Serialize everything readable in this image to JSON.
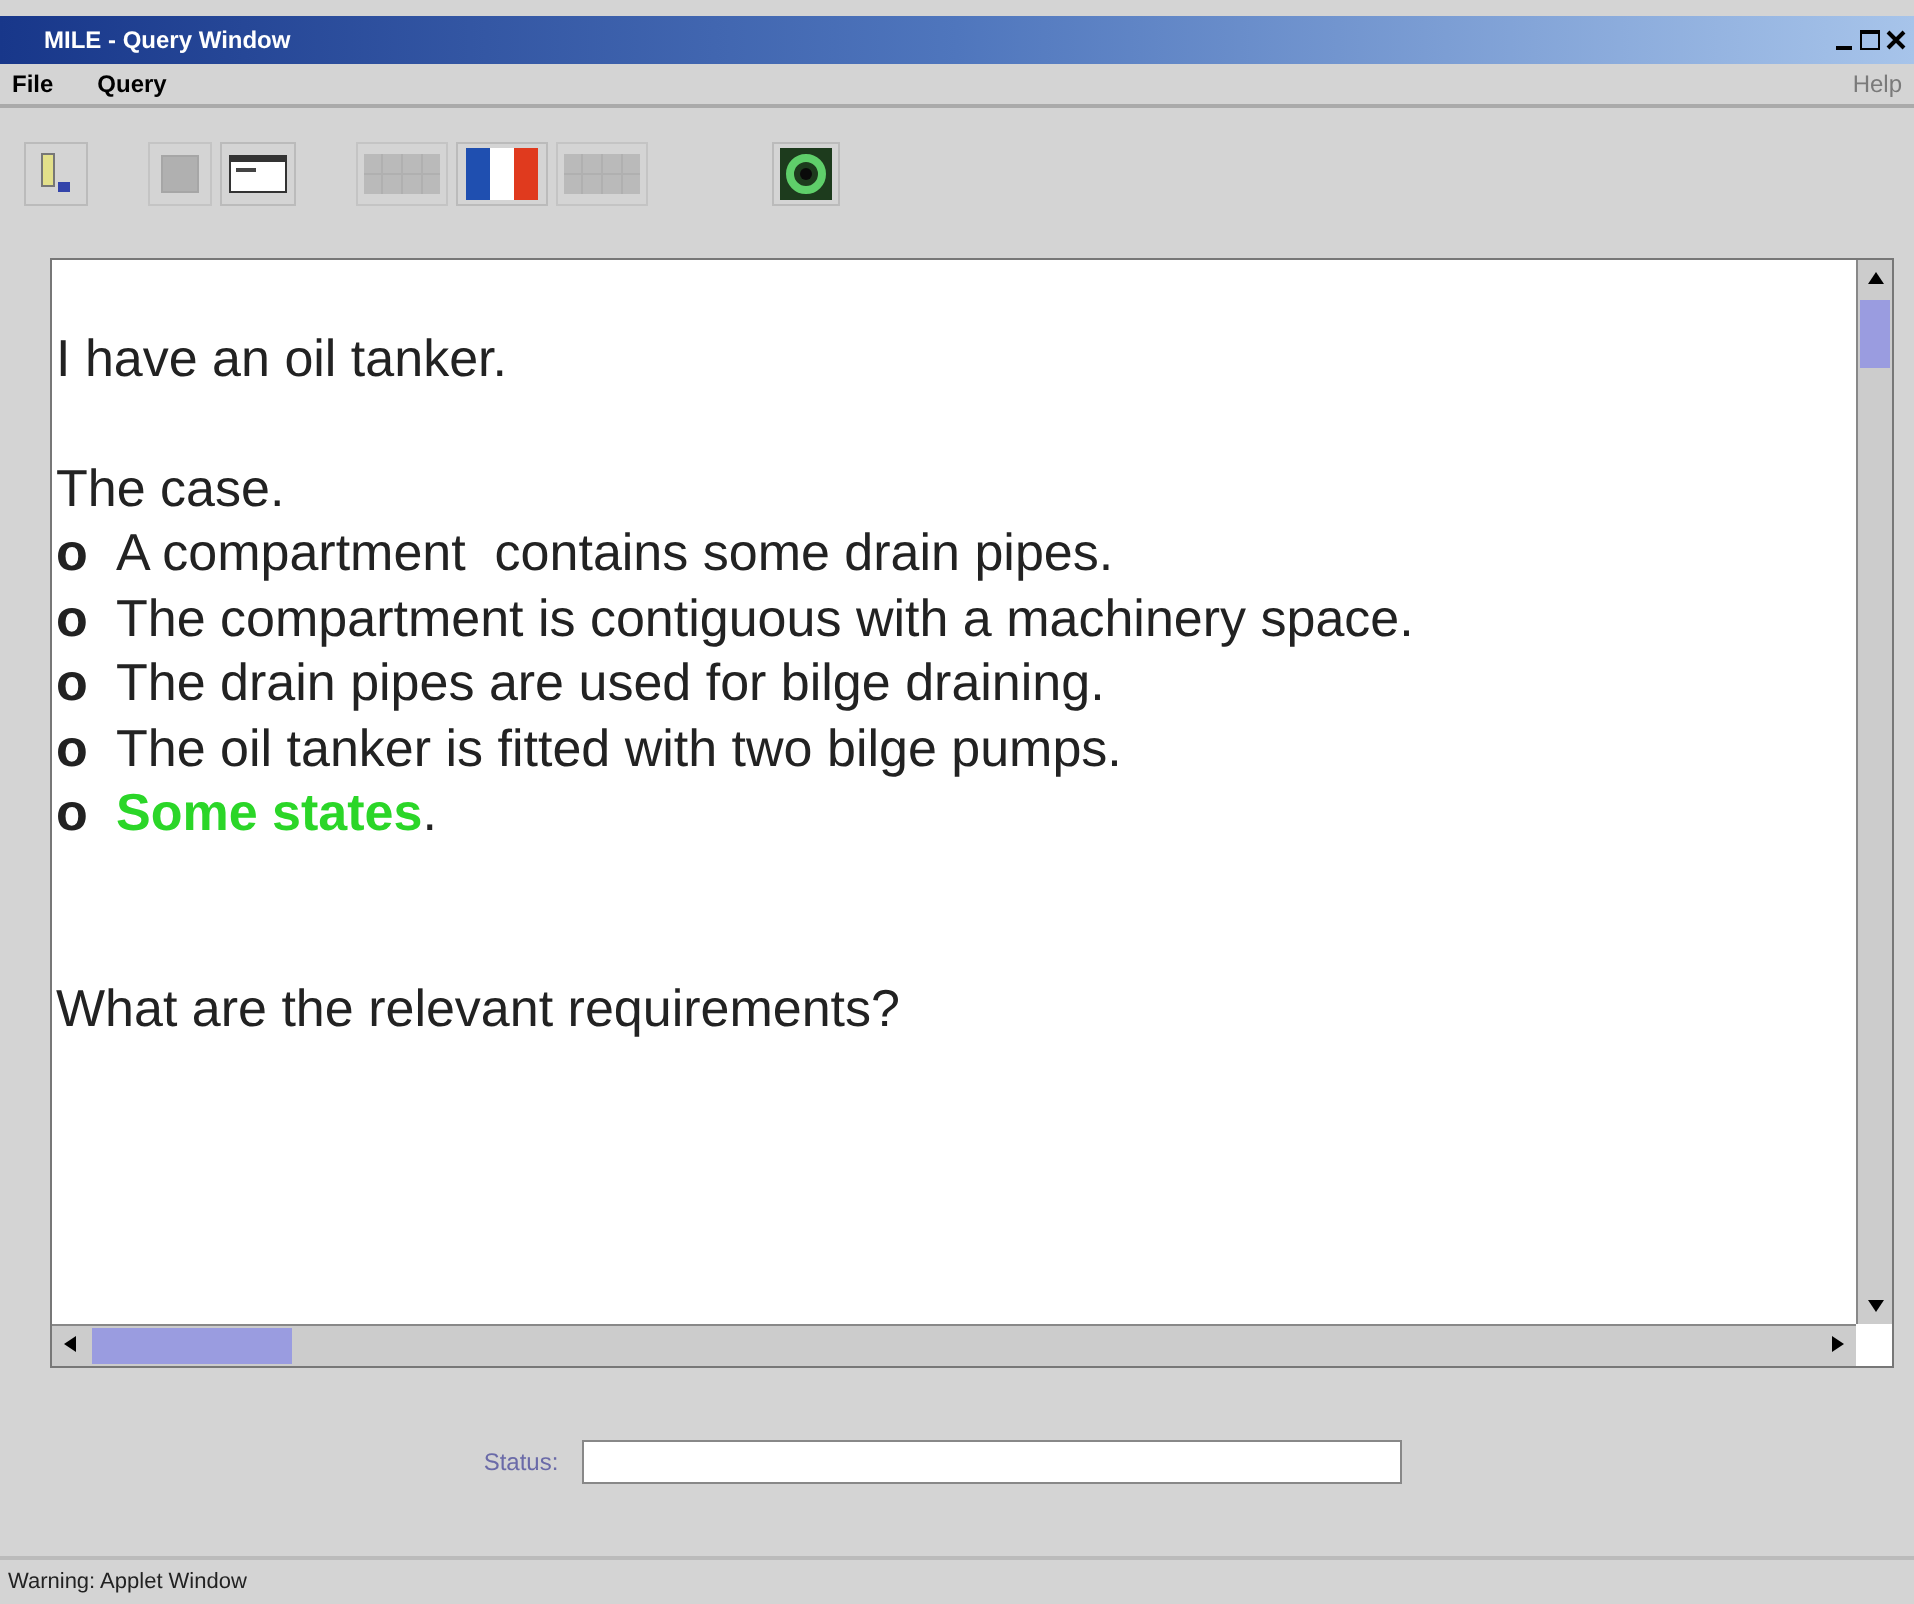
{
  "window": {
    "title": "MILE - Query Window"
  },
  "menu": [
    {
      "label": "File",
      "disabled": false
    },
    {
      "label": "Query",
      "disabled": false
    },
    {
      "label": "Help",
      "disabled": true
    }
  ],
  "toolbar": [
    {
      "kind": "paste",
      "disabled": false
    },
    {
      "kind": "stop",
      "disabled": true
    },
    {
      "kind": "window",
      "disabled": false
    },
    {
      "kind": "grid",
      "disabled": true
    },
    {
      "kind": "flag",
      "disabled": false
    },
    {
      "kind": "grid",
      "disabled": true
    },
    {
      "kind": "recycle",
      "disabled": false
    }
  ],
  "document": {
    "lines": [
      {
        "kind": "blank"
      },
      {
        "kind": "text",
        "parts": [
          {
            "text": "I have an oil tanker.",
            "highlighted": false
          }
        ]
      },
      {
        "kind": "blank"
      },
      {
        "kind": "text",
        "parts": [
          {
            "text": "The case.",
            "highlighted": false
          }
        ]
      },
      {
        "kind": "bullet",
        "bullet": "o",
        "parts": [
          {
            "text": "A compartment  contains some drain pipes.",
            "highlighted": false
          }
        ]
      },
      {
        "kind": "bullet",
        "bullet": "o",
        "parts": [
          {
            "text": "The compartment is contiguous with a machinery space.",
            "highlighted": false
          }
        ]
      },
      {
        "kind": "bullet",
        "bullet": "o",
        "parts": [
          {
            "text": "The drain pipes are used for bilge draining.",
            "highlighted": false
          }
        ]
      },
      {
        "kind": "bullet",
        "bullet": "o",
        "parts": [
          {
            "text": "The oil tanker is fitted with two bilge pumps.",
            "highlighted": false
          }
        ]
      },
      {
        "kind": "bullet",
        "bullet": "o",
        "parts": [
          {
            "text": "Some states",
            "highlighted": true
          },
          {
            "text": ".",
            "highlighted": false
          }
        ]
      },
      {
        "kind": "blank"
      },
      {
        "kind": "blank"
      },
      {
        "kind": "text",
        "parts": [
          {
            "text": "What are the relevant requirements?",
            "highlighted": false
          }
        ]
      }
    ]
  },
  "status": {
    "label": "Status:"
  },
  "status_bar": {
    "text": "Warning: Applet Window"
  }
}
